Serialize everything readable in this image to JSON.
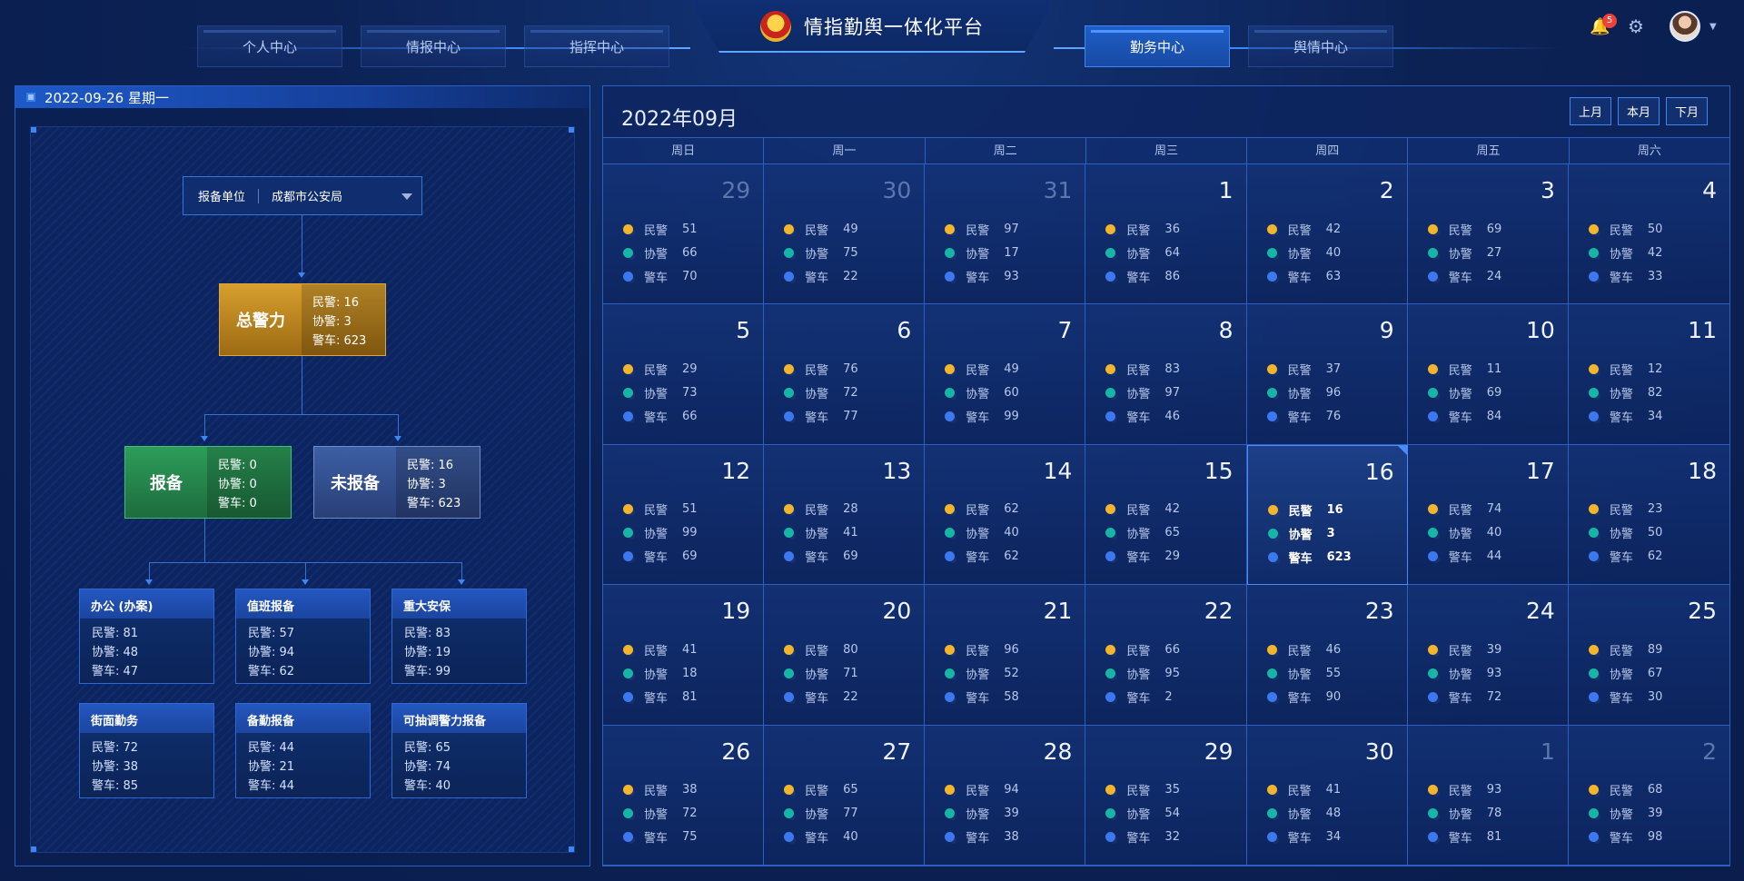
{
  "header": {
    "title": "情指勤舆一体化平台",
    "nav_left": [
      "个人中心",
      "情报中心",
      "指挥中心"
    ],
    "nav_right": [
      "勤务中心",
      "舆情中心"
    ],
    "active_nav": "勤务中心",
    "notification_count": "5"
  },
  "left": {
    "date": "2022-09-26 星期一",
    "unit_label": "报备单位",
    "unit_value": "成都市公安局",
    "total": {
      "title": "总警力",
      "police": "民警: 16",
      "aux": "协警: 3",
      "cars": "警车: 623"
    },
    "reported": {
      "title": "报备",
      "police": "民警: 0",
      "aux": "协警: 0",
      "cars": "警车: 0"
    },
    "unreported": {
      "title": "未报备",
      "police": "民警: 16",
      "aux": "协警: 3",
      "cars": "警车: 623"
    },
    "cards": [
      {
        "title": "办公 (办案)",
        "police": "民警: 81",
        "aux": "协警: 48",
        "cars": "警车: 47"
      },
      {
        "title": "值班报备",
        "police": "民警: 57",
        "aux": "协警: 94",
        "cars": "警车: 62"
      },
      {
        "title": "重大安保",
        "police": "民警: 83",
        "aux": "协警: 19",
        "cars": "警车: 99"
      },
      {
        "title": "街面勤务",
        "police": "民警: 72",
        "aux": "协警: 38",
        "cars": "警车: 85"
      },
      {
        "title": "备勤报备",
        "police": "民警: 44",
        "aux": "协警: 21",
        "cars": "警车: 44"
      },
      {
        "title": "可抽调警力报备",
        "police": "民警: 65",
        "aux": "协警: 74",
        "cars": "警车: 40"
      }
    ]
  },
  "calendar": {
    "title": "2022年09月",
    "buttons": {
      "prev": "上月",
      "current": "本月",
      "next": "下月"
    },
    "weekdays": [
      "周日",
      "周一",
      "周二",
      "周三",
      "周四",
      "周五",
      "周六"
    ],
    "labels": {
      "police": "民警",
      "aux": "协警",
      "cars": "警车"
    },
    "colors": {
      "police": "#f2b52b",
      "aux": "#16b5a5",
      "cars": "#3c78f0"
    },
    "today": "16",
    "cells": [
      {
        "day": "29",
        "other": true,
        "v": [
          "51",
          "66",
          "70"
        ]
      },
      {
        "day": "30",
        "other": true,
        "v": [
          "49",
          "75",
          "22"
        ]
      },
      {
        "day": "31",
        "other": true,
        "v": [
          "97",
          "17",
          "93"
        ]
      },
      {
        "day": "1",
        "v": [
          "36",
          "64",
          "86"
        ]
      },
      {
        "day": "2",
        "v": [
          "42",
          "40",
          "63"
        ]
      },
      {
        "day": "3",
        "v": [
          "69",
          "27",
          "24"
        ]
      },
      {
        "day": "4",
        "v": [
          "50",
          "42",
          "33"
        ]
      },
      {
        "day": "5",
        "v": [
          "29",
          "73",
          "66"
        ]
      },
      {
        "day": "6",
        "v": [
          "76",
          "72",
          "77"
        ]
      },
      {
        "day": "7",
        "v": [
          "49",
          "60",
          "99"
        ]
      },
      {
        "day": "8",
        "v": [
          "83",
          "97",
          "46"
        ]
      },
      {
        "day": "9",
        "v": [
          "37",
          "96",
          "76"
        ]
      },
      {
        "day": "10",
        "v": [
          "11",
          "69",
          "84"
        ]
      },
      {
        "day": "11",
        "v": [
          "12",
          "82",
          "34"
        ]
      },
      {
        "day": "12",
        "v": [
          "51",
          "99",
          "69"
        ]
      },
      {
        "day": "13",
        "v": [
          "28",
          "41",
          "69"
        ]
      },
      {
        "day": "14",
        "v": [
          "62",
          "40",
          "62"
        ]
      },
      {
        "day": "15",
        "v": [
          "42",
          "65",
          "29"
        ]
      },
      {
        "day": "16",
        "v": [
          "16",
          "3",
          "623"
        ]
      },
      {
        "day": "17",
        "v": [
          "74",
          "40",
          "44"
        ]
      },
      {
        "day": "18",
        "v": [
          "23",
          "50",
          "62"
        ]
      },
      {
        "day": "19",
        "v": [
          "41",
          "18",
          "81"
        ]
      },
      {
        "day": "20",
        "v": [
          "80",
          "71",
          "22"
        ]
      },
      {
        "day": "21",
        "v": [
          "96",
          "52",
          "58"
        ]
      },
      {
        "day": "22",
        "v": [
          "66",
          "95",
          "2"
        ]
      },
      {
        "day": "23",
        "v": [
          "46",
          "55",
          "90"
        ]
      },
      {
        "day": "24",
        "v": [
          "39",
          "93",
          "72"
        ]
      },
      {
        "day": "25",
        "v": [
          "89",
          "67",
          "30"
        ]
      },
      {
        "day": "26",
        "v": [
          "38",
          "72",
          "75"
        ]
      },
      {
        "day": "27",
        "v": [
          "65",
          "77",
          "40"
        ]
      },
      {
        "day": "28",
        "v": [
          "94",
          "39",
          "38"
        ]
      },
      {
        "day": "29",
        "v": [
          "35",
          "54",
          "32"
        ]
      },
      {
        "day": "30",
        "v": [
          "41",
          "48",
          "34"
        ]
      },
      {
        "day": "1",
        "other": true,
        "v": [
          "93",
          "78",
          "81"
        ]
      },
      {
        "day": "2",
        "other": true,
        "v": [
          "68",
          "39",
          "98"
        ]
      }
    ]
  }
}
